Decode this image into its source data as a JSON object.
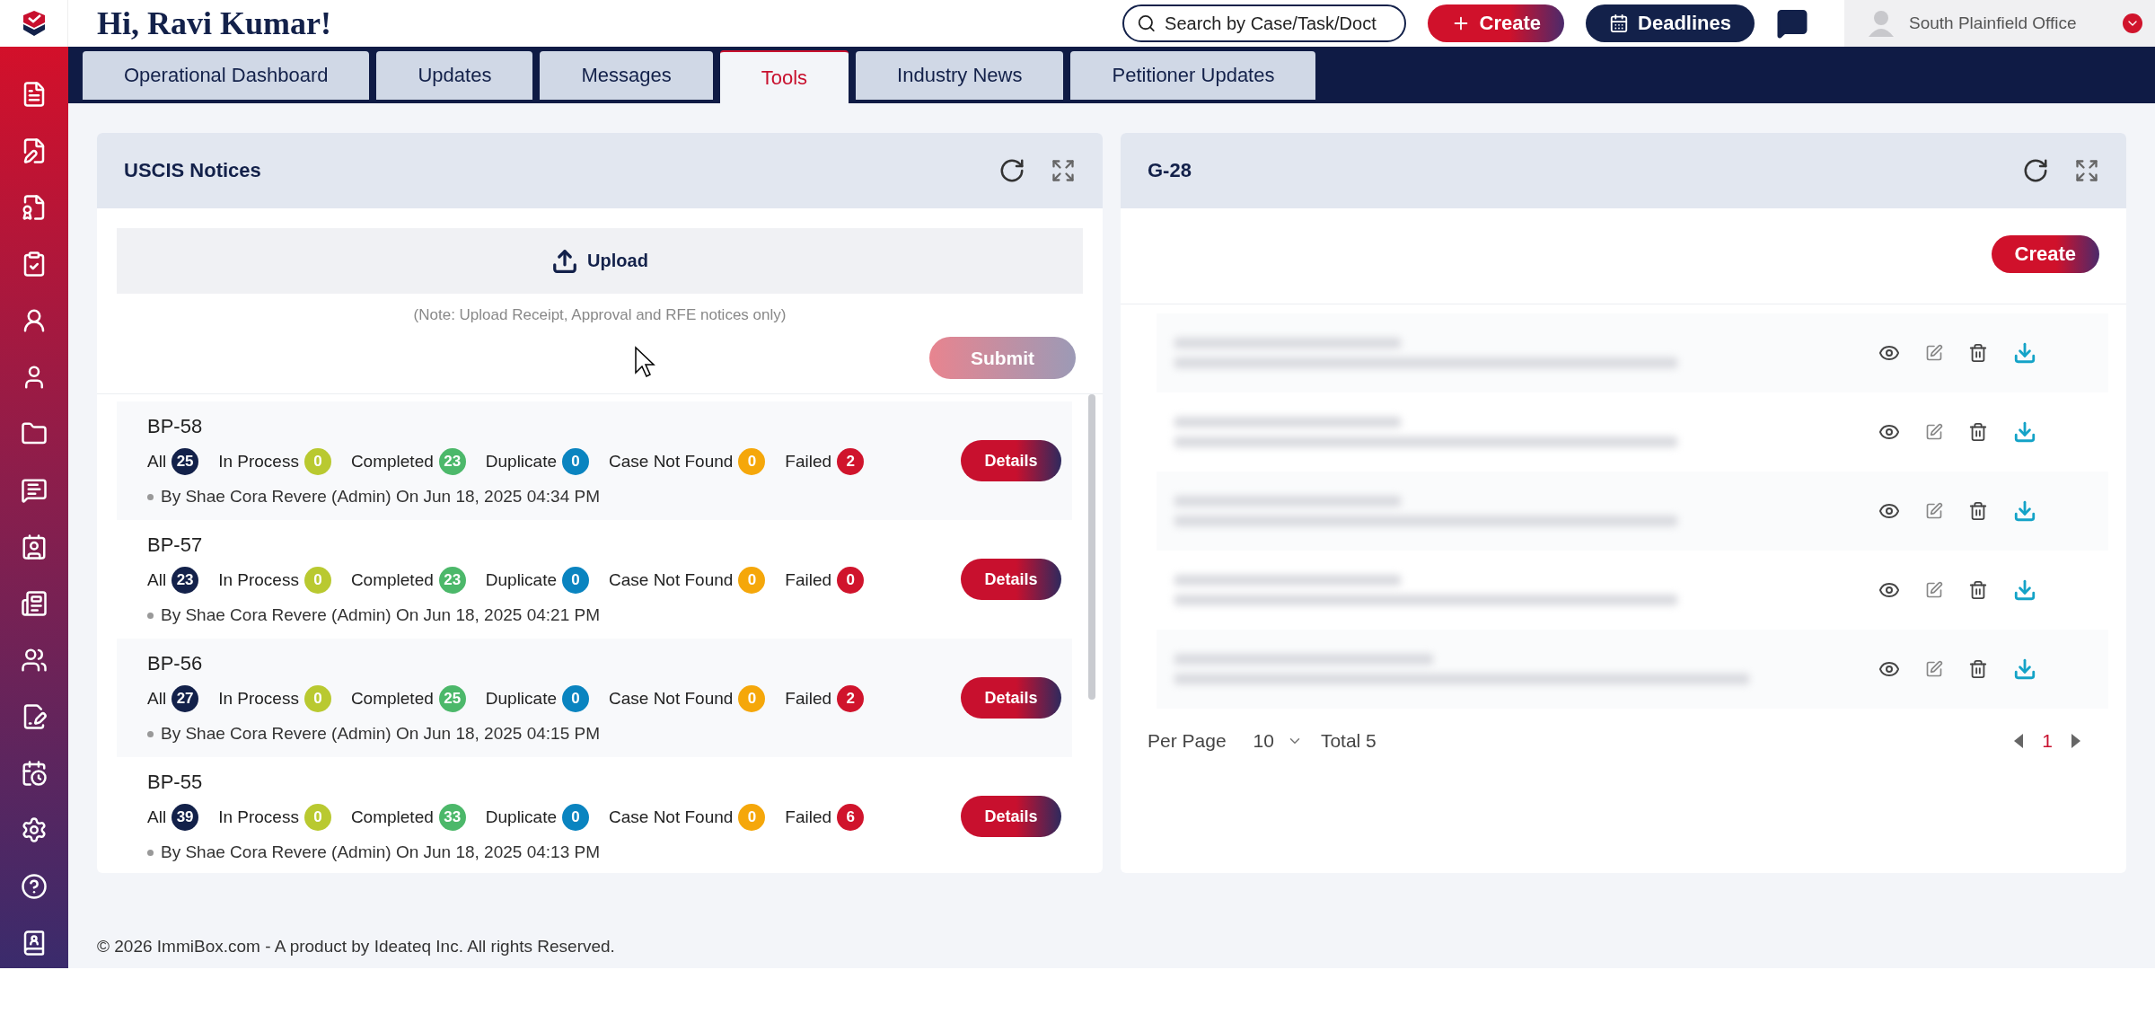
{
  "header": {
    "greeting": "Hi, Ravi Kumar!",
    "search": {
      "placeholder": "Search by Case/Task/Doct"
    },
    "create_button": "Create",
    "deadlines_button": "Deadlines",
    "office": "South Plainfield Office"
  },
  "tabs": [
    {
      "label": "Operational Dashboard",
      "selected": false
    },
    {
      "label": "Updates",
      "selected": false
    },
    {
      "label": "Messages",
      "selected": false
    },
    {
      "label": "Tools",
      "selected": true
    },
    {
      "label": "Industry News",
      "selected": false
    },
    {
      "label": "Petitioner Updates",
      "selected": false
    }
  ],
  "uscis": {
    "title": "USCIS Notices",
    "upload_label": "Upload",
    "note": "(Note: Upload Receipt, Approval and RFE notices only)",
    "submit": {
      "label": "Submit",
      "disabled": true
    },
    "batches": [
      {
        "name": "BP-58",
        "counts": [
          {
            "label": "All",
            "value": "25",
            "color": "#13214a"
          },
          {
            "label": "In Process",
            "value": "0",
            "color": "#b9c930"
          },
          {
            "label": "Completed",
            "value": "23",
            "color": "#4cb86a"
          },
          {
            "label": "Duplicate",
            "value": "0",
            "color": "#0a84c0"
          },
          {
            "label": "Case Not Found",
            "value": "0",
            "color": "#f5a70a"
          },
          {
            "label": "Failed",
            "value": "2",
            "color": "#d0142c"
          }
        ],
        "meta": "By Shae Cora Revere (Admin) On Jun 18, 2025 04:34 PM",
        "action": "Details"
      },
      {
        "name": "BP-57",
        "counts": [
          {
            "label": "All",
            "value": "23",
            "color": "#13214a"
          },
          {
            "label": "In Process",
            "value": "0",
            "color": "#b9c930"
          },
          {
            "label": "Completed",
            "value": "23",
            "color": "#4cb86a"
          },
          {
            "label": "Duplicate",
            "value": "0",
            "color": "#0a84c0"
          },
          {
            "label": "Case Not Found",
            "value": "0",
            "color": "#f5a70a"
          },
          {
            "label": "Failed",
            "value": "0",
            "color": "#d0142c"
          }
        ],
        "meta": "By Shae Cora Revere (Admin) On Jun 18, 2025 04:21 PM",
        "action": "Details"
      },
      {
        "name": "BP-56",
        "counts": [
          {
            "label": "All",
            "value": "27",
            "color": "#13214a"
          },
          {
            "label": "In Process",
            "value": "0",
            "color": "#b9c930"
          },
          {
            "label": "Completed",
            "value": "25",
            "color": "#4cb86a"
          },
          {
            "label": "Duplicate",
            "value": "0",
            "color": "#0a84c0"
          },
          {
            "label": "Case Not Found",
            "value": "0",
            "color": "#f5a70a"
          },
          {
            "label": "Failed",
            "value": "2",
            "color": "#d0142c"
          }
        ],
        "meta": "By Shae Cora Revere (Admin) On Jun 18, 2025 04:15 PM",
        "action": "Details"
      },
      {
        "name": "BP-55",
        "counts": [
          {
            "label": "All",
            "value": "39",
            "color": "#13214a"
          },
          {
            "label": "In Process",
            "value": "0",
            "color": "#b9c930"
          },
          {
            "label": "Completed",
            "value": "33",
            "color": "#4cb86a"
          },
          {
            "label": "Duplicate",
            "value": "0",
            "color": "#0a84c0"
          },
          {
            "label": "Case Not Found",
            "value": "0",
            "color": "#f5a70a"
          },
          {
            "label": "Failed",
            "value": "6",
            "color": "#d0142c"
          }
        ],
        "meta": "By Shae Cora Revere (Admin) On Jun 18, 2025 04:13 PM",
        "action": "Details"
      }
    ]
  },
  "g28": {
    "title": "G-28",
    "create_button": "Create",
    "records": [
      {
        "blurred": true
      },
      {
        "blurred": true
      },
      {
        "blurred": true
      },
      {
        "blurred": true
      },
      {
        "blurred": true
      }
    ],
    "pagination": {
      "per_page_label": "Per Page",
      "per_page": "10",
      "total": "Total 5",
      "current_page": "1"
    }
  },
  "footer": "© 2026 ImmiBox.com - A product by Ideateq Inc. All rights Reserved."
}
